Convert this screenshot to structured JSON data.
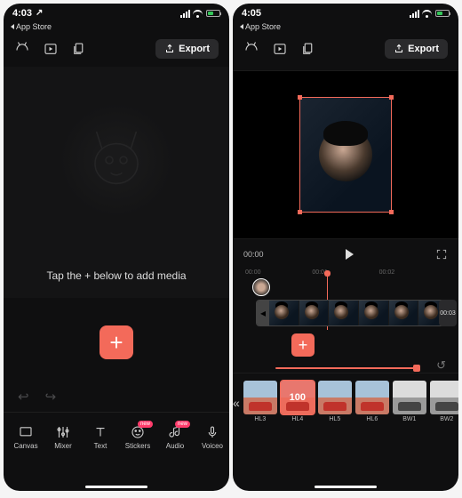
{
  "left": {
    "status": {
      "time": "4:03",
      "back_app": "App Store"
    },
    "export_label": "Export",
    "empty_text": "Tap the + below to add media",
    "toolbar": [
      {
        "id": "canvas",
        "label": "Canvas"
      },
      {
        "id": "mixer",
        "label": "Mixer"
      },
      {
        "id": "text",
        "label": "Text"
      },
      {
        "id": "stickers",
        "label": "Stickers",
        "badge": "new"
      },
      {
        "id": "audio",
        "label": "Audio",
        "badge": "new"
      },
      {
        "id": "voiceover",
        "label": "Voiceo"
      }
    ]
  },
  "right": {
    "status": {
      "time": "4:05",
      "back_app": "App Store"
    },
    "export_label": "Export",
    "playback": {
      "current": "00:00",
      "timecodes": [
        "00:00",
        "00:01",
        "00:02"
      ],
      "clip_end": "00:03"
    },
    "filter_selected_value": "100",
    "filters": [
      {
        "id": "HL3",
        "label": "HL3",
        "kind": "color"
      },
      {
        "id": "HL4",
        "label": "HL4",
        "kind": "color",
        "selected": true
      },
      {
        "id": "HL5",
        "label": "HL5",
        "kind": "color"
      },
      {
        "id": "HL6",
        "label": "HL6",
        "kind": "color"
      },
      {
        "id": "BW1",
        "label": "BW1",
        "kind": "bw"
      },
      {
        "id": "BW2",
        "label": "BW2",
        "kind": "bw"
      }
    ]
  }
}
